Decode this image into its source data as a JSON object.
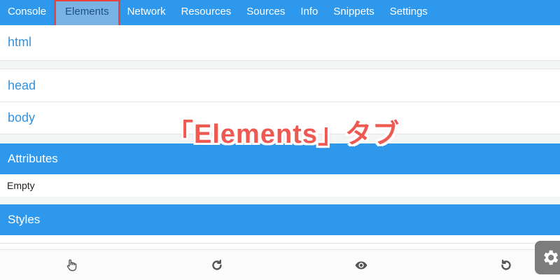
{
  "tabs": [
    {
      "label": "Console"
    },
    {
      "label": "Elements"
    },
    {
      "label": "Network"
    },
    {
      "label": "Resources"
    },
    {
      "label": "Sources"
    },
    {
      "label": "Info"
    },
    {
      "label": "Snippets"
    },
    {
      "label": "Settings"
    }
  ],
  "active_tab": "Elements",
  "tree": {
    "root": "html",
    "children": [
      "head",
      "body"
    ]
  },
  "attributes": {
    "header": "Attributes",
    "value": "Empty"
  },
  "styles": {
    "header": "Styles"
  },
  "caption": "「Elements」タブ",
  "toolbar": {
    "icons": [
      "pointer-hand-icon",
      "refresh-icon",
      "eye-icon",
      "undo-icon",
      "gear-icon"
    ]
  },
  "colors": {
    "accent": "#2e98ec",
    "link": "#3392dd",
    "highlight": "#e8453c",
    "caption": "#ee5a52"
  }
}
